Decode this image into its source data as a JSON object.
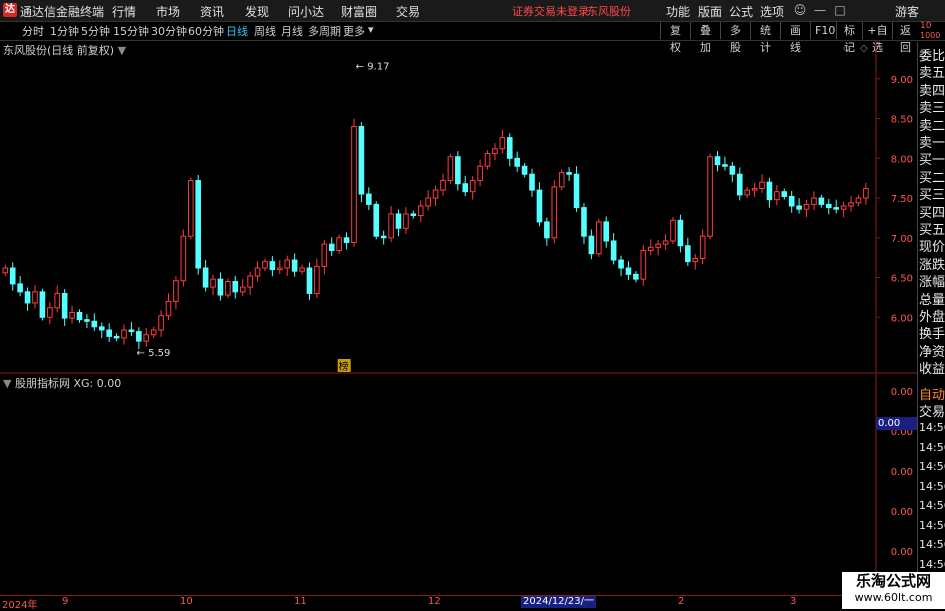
{
  "titlebar": {
    "logo": "达",
    "app_title": "通达信金融终端",
    "menus": [
      "行情",
      "市场",
      "资讯",
      "发现",
      "问小达",
      "财富圈",
      "交易"
    ],
    "warning": "证券交易未登录",
    "stock_name": "东风股份",
    "right_menus": [
      "功能",
      "版面",
      "公式",
      "选项"
    ],
    "guest": "游客"
  },
  "periodbar": {
    "periods": [
      "分时",
      "1分钟",
      "5分钟",
      "15分钟",
      "30分钟",
      "60分钟",
      "日线",
      "周线",
      "月线",
      "多周期",
      "更多"
    ],
    "active": "日线",
    "tools": [
      "复权",
      "叠加",
      "多股",
      "统计",
      "画线",
      "F10",
      "标记",
      "+自选",
      "返回"
    ]
  },
  "main_chart": {
    "label": "东风股份(日线 前复权)",
    "high_label": "9.17",
    "low_label": "5.59",
    "bang_label": "榜",
    "y_ticks": [
      "9.00",
      "8.50",
      "8.00",
      "7.50",
      "7.00",
      "6.50",
      "6.00"
    ]
  },
  "sub_chart": {
    "label": "股朋指标网 XG: 0.00",
    "y_ticks": [
      "0.00",
      "0.00",
      "0.00",
      "0.00",
      "0.00"
    ],
    "current_value": "0.00"
  },
  "right_panel": {
    "top_items": [
      "委比",
      "卖五",
      "卖四",
      "卖三",
      "卖二",
      "卖一",
      "买一",
      "买二",
      "买三",
      "买四",
      "买五",
      "现价",
      "涨跌",
      "涨幅",
      "总量",
      "外盘",
      "换手",
      "净资",
      "收益"
    ],
    "mid_items": [
      "自动",
      "交易"
    ],
    "time_items": [
      "14:56",
      "14:56",
      "14:56",
      "14:56",
      "14:56",
      "14:56",
      "14:56",
      "14:56",
      "14:56"
    ],
    "corner_top": "10",
    "corner_bottom": "1000"
  },
  "bottom_axis": {
    "ticks": [
      "2024年",
      "9",
      "10",
      "11",
      "12",
      "2",
      "3"
    ],
    "cursor_date": "2024/12/23/一"
  },
  "watermark": {
    "title": "乐淘公式网",
    "url": "www.60lt.com"
  },
  "colors": {
    "up": "#ff3b3b",
    "down": "#54ffff",
    "axis": "#ff5555",
    "active_period": "#2ec7f0",
    "separator": "#8b1a1a"
  },
  "chart_data": {
    "type": "candlestick",
    "title": "东风股份(日线 前复权)",
    "ylim": [
      5.45,
      9.35
    ],
    "y_ticks": [
      9.0,
      8.5,
      8.0,
      7.5,
      7.0,
      6.5,
      6.0
    ],
    "high": 9.17,
    "low": 5.59,
    "series": [
      {
        "values_close": [
          6.62,
          6.42,
          6.32,
          6.18,
          6.32,
          6.0,
          6.12,
          6.3,
          5.99,
          6.06,
          5.97,
          5.95,
          5.88,
          5.84,
          5.76,
          5.74,
          5.84,
          5.82,
          5.7,
          5.78,
          5.84,
          6.02,
          6.2,
          6.46,
          7.02,
          7.72,
          6.62,
          6.38,
          6.48,
          6.28,
          6.45,
          6.32,
          6.38,
          6.52,
          6.62,
          6.7,
          6.6,
          6.62,
          6.72,
          6.58,
          6.62,
          6.3,
          6.64,
          6.92,
          6.84,
          7.0,
          6.94,
          8.4,
          7.55,
          7.42,
          7.02,
          7.0,
          7.3,
          7.12,
          7.3,
          7.28,
          7.4,
          7.5,
          7.6,
          7.72,
          8.02,
          7.68,
          7.58,
          7.72,
          7.9,
          8.06,
          8.12,
          8.26,
          8.0,
          7.9,
          7.8,
          7.6,
          7.2,
          7.0,
          7.64,
          7.82,
          7.8,
          7.38,
          7.02,
          6.8,
          7.2,
          6.96,
          6.72,
          6.62,
          6.54,
          6.48,
          6.84,
          6.88,
          6.92,
          6.96,
          7.22,
          6.9,
          6.7,
          6.74,
          7.02,
          8.02,
          7.92,
          7.9,
          7.8,
          7.54,
          7.6,
          7.62,
          7.7,
          7.48,
          7.58,
          7.52,
          7.4,
          7.36,
          7.42,
          7.5,
          7.42,
          7.38,
          7.36,
          7.4,
          7.44,
          7.5,
          7.62
        ]
      }
    ]
  }
}
